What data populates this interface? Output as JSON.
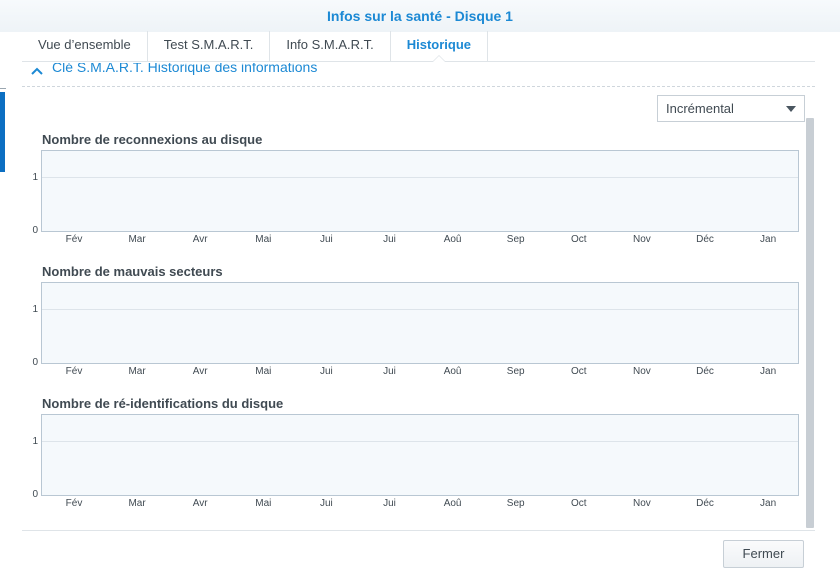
{
  "window": {
    "title": "Infos sur la santé - Disque 1"
  },
  "tabs": [
    {
      "label": "Vue d’ensemble",
      "active": false
    },
    {
      "label": "Test S.M.A.R.T.",
      "active": false
    },
    {
      "label": "Info S.M.A.R.T.",
      "active": false
    },
    {
      "label": "Historique",
      "active": true
    }
  ],
  "section": {
    "header": "Clé S.M.A.R.T. Historique des informations",
    "icon": "chevron-up-icon"
  },
  "mode_select": {
    "value": "Incrémental",
    "icon": "caret-down-icon"
  },
  "chart_data": [
    {
      "type": "line",
      "title": "Nombre de reconnexions au disque",
      "x": [
        "Fév",
        "Mar",
        "Avr",
        "Mai",
        "Jui",
        "Jui",
        "Aoû",
        "Sep",
        "Oct",
        "Nov",
        "Déc",
        "Jan"
      ],
      "yticks": [
        0,
        1
      ],
      "ylim": [
        0,
        1.5
      ],
      "series": [],
      "grid": true
    },
    {
      "type": "line",
      "title": "Nombre de mauvais secteurs",
      "x": [
        "Fév",
        "Mar",
        "Avr",
        "Mai",
        "Jui",
        "Jui",
        "Aoû",
        "Sep",
        "Oct",
        "Nov",
        "Déc",
        "Jan"
      ],
      "yticks": [
        0,
        1
      ],
      "ylim": [
        0,
        1.5
      ],
      "series": [],
      "grid": true
    },
    {
      "type": "line",
      "title": "Nombre de ré-identifications du disque",
      "x": [
        "Fév",
        "Mar",
        "Avr",
        "Mai",
        "Jui",
        "Jui",
        "Aoû",
        "Sep",
        "Oct",
        "Nov",
        "Déc",
        "Jan"
      ],
      "yticks": [
        0,
        1
      ],
      "ylim": [
        0,
        1.5
      ],
      "series": [],
      "grid": true
    }
  ],
  "footer": {
    "close_label": "Fermer"
  },
  "colors": {
    "accent": "#1c89d4",
    "text": "#404a52",
    "plot_bg": "#f5f9fc",
    "plot_border": "#b9c7d3"
  }
}
